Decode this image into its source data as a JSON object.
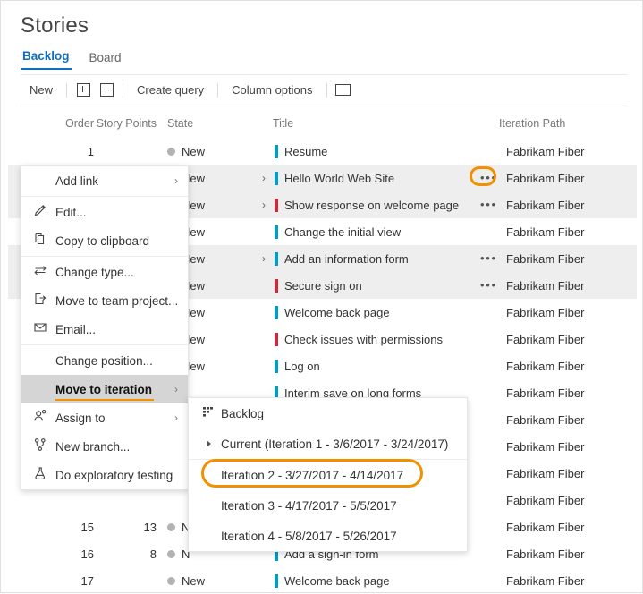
{
  "page": {
    "title": "Stories"
  },
  "tabs": [
    {
      "label": "Backlog",
      "active": true
    },
    {
      "label": "Board",
      "active": false
    }
  ],
  "toolbar": {
    "new_label": "New",
    "expand_icon": "plus-box-icon",
    "collapse_icon": "minus-box-icon",
    "create_query_label": "Create query",
    "column_options_label": "Column options",
    "email_icon": "envelope-icon"
  },
  "grid": {
    "columns": [
      "Order",
      "Story Points",
      "State",
      "Title",
      "Iteration Path"
    ],
    "rows": [
      {
        "order": "1",
        "points": "",
        "state": "New",
        "title": "Resume",
        "type": "story",
        "expandable": false,
        "ellipsis": false,
        "iteration": "Fabrikam Fiber",
        "selected": false
      },
      {
        "order": "",
        "points": "",
        "state": "New",
        "title": "Hello World Web Site",
        "type": "story",
        "expandable": true,
        "ellipsis": true,
        "iteration": "Fabrikam Fiber",
        "selected": true
      },
      {
        "order": "",
        "points": "",
        "state": "New",
        "title": "Show response on welcome page",
        "type": "bug",
        "expandable": true,
        "ellipsis": true,
        "iteration": "Fabrikam Fiber",
        "selected": true
      },
      {
        "order": "",
        "points": "",
        "state": "New",
        "title": "Change the initial view",
        "type": "story",
        "expandable": false,
        "ellipsis": false,
        "iteration": "Fabrikam Fiber",
        "selected": false
      },
      {
        "order": "",
        "points": "",
        "state": "New",
        "title": "Add an information form",
        "type": "story",
        "expandable": true,
        "ellipsis": true,
        "iteration": "Fabrikam Fiber",
        "selected": true
      },
      {
        "order": "",
        "points": "",
        "state": "New",
        "title": "Secure sign on",
        "type": "bug",
        "expandable": false,
        "ellipsis": true,
        "iteration": "Fabrikam Fiber",
        "selected": true
      },
      {
        "order": "",
        "points": "",
        "state": "New",
        "title": "Welcome back page",
        "type": "story",
        "expandable": false,
        "ellipsis": false,
        "iteration": "Fabrikam Fiber",
        "selected": false
      },
      {
        "order": "",
        "points": "",
        "state": "New",
        "title": "Check issues with permissions",
        "type": "bug",
        "expandable": false,
        "ellipsis": false,
        "iteration": "Fabrikam Fiber",
        "selected": false
      },
      {
        "order": "",
        "points": "",
        "state": "New",
        "title": "Log on",
        "type": "story",
        "expandable": false,
        "ellipsis": false,
        "iteration": "Fabrikam Fiber",
        "selected": false
      },
      {
        "order": "",
        "points": "",
        "state": "",
        "title": "Interim save on long forms",
        "type": "story",
        "expandable": false,
        "ellipsis": false,
        "iteration": "Fabrikam Fiber",
        "selected": false
      },
      {
        "order": "",
        "points": "",
        "state": "",
        "title": "",
        "type": "none",
        "expandable": false,
        "ellipsis": false,
        "iteration": "Fabrikam Fiber",
        "selected": false
      },
      {
        "order": "",
        "points": "",
        "state": "",
        "title": "",
        "type": "none",
        "expandable": false,
        "ellipsis": false,
        "iteration": "Fabrikam Fiber",
        "selected": false
      },
      {
        "order": "",
        "points": "",
        "state": "",
        "title": "",
        "type": "none",
        "expandable": false,
        "ellipsis": false,
        "iteration": "Fabrikam Fiber",
        "selected": false
      },
      {
        "order": "",
        "points": "",
        "state": "",
        "title": "",
        "type": "none",
        "expandable": false,
        "ellipsis": false,
        "iteration": "Fabrikam Fiber",
        "selected": false
      },
      {
        "order": "15",
        "points": "13",
        "state": "N",
        "title": "",
        "type": "none",
        "expandable": false,
        "ellipsis": false,
        "iteration": "Fabrikam Fiber",
        "selected": false
      },
      {
        "order": "16",
        "points": "8",
        "state": "N",
        "title": "Add a sign-in form",
        "type": "story",
        "expandable": false,
        "ellipsis": false,
        "iteration": "Fabrikam Fiber",
        "selected": false
      },
      {
        "order": "17",
        "points": "",
        "state": "New",
        "title": "Welcome back page",
        "type": "story",
        "expandable": false,
        "ellipsis": false,
        "iteration": "Fabrikam Fiber",
        "selected": false
      }
    ]
  },
  "context_menu": {
    "items": [
      {
        "label": "Add link",
        "icon": "",
        "submenu": true,
        "highlighted": false,
        "divider_after": true
      },
      {
        "label": "Edit...",
        "icon": "pencil-icon",
        "submenu": false,
        "highlighted": false,
        "divider_after": false
      },
      {
        "label": "Copy to clipboard",
        "icon": "copy-icon",
        "submenu": false,
        "highlighted": false,
        "divider_after": true
      },
      {
        "label": "Change type...",
        "icon": "swap-arrows-icon",
        "submenu": false,
        "highlighted": false,
        "divider_after": false
      },
      {
        "label": "Move to team project...",
        "icon": "move-out-icon",
        "submenu": false,
        "highlighted": false,
        "divider_after": false
      },
      {
        "label": "Email...",
        "icon": "envelope-icon",
        "submenu": false,
        "highlighted": false,
        "divider_after": true
      },
      {
        "label": "Change position...",
        "icon": "",
        "submenu": false,
        "highlighted": false,
        "divider_after": false
      },
      {
        "label": "Move to iteration",
        "icon": "",
        "submenu": true,
        "highlighted": true,
        "divider_after": false
      },
      {
        "label": "Assign to",
        "icon": "person-icon",
        "submenu": true,
        "highlighted": false,
        "divider_after": false
      },
      {
        "label": "New branch...",
        "icon": "branch-icon",
        "submenu": false,
        "highlighted": false,
        "divider_after": false
      },
      {
        "label": "Do exploratory testing",
        "icon": "flask-icon",
        "submenu": false,
        "highlighted": false,
        "divider_after": false
      }
    ]
  },
  "submenu": {
    "items": [
      {
        "label": "Backlog",
        "icon": "backlog-grid-icon",
        "expander": false,
        "divider_after": false,
        "highlighted": false
      },
      {
        "label": "Current (Iteration 1 - 3/6/2017 - 3/24/2017)",
        "icon": "",
        "expander": true,
        "divider_after": true,
        "highlighted": false
      },
      {
        "label": "Iteration 2 - 3/27/2017 - 4/14/2017",
        "icon": "",
        "expander": false,
        "divider_after": false,
        "highlighted": true
      },
      {
        "label": "Iteration 3 - 4/17/2017 - 5/5/2017",
        "icon": "",
        "expander": false,
        "divider_after": false,
        "highlighted": false
      },
      {
        "label": "Iteration 4 - 5/8/2017 - 5/26/2017",
        "icon": "",
        "expander": false,
        "divider_after": false,
        "highlighted": false
      }
    ]
  },
  "colors": {
    "accent_link": "#106ebe",
    "highlight_orange": "#f29100",
    "story_bar": "#009ccc",
    "bug_bar": "#cc293d",
    "row_selected": "#eeeeee"
  }
}
